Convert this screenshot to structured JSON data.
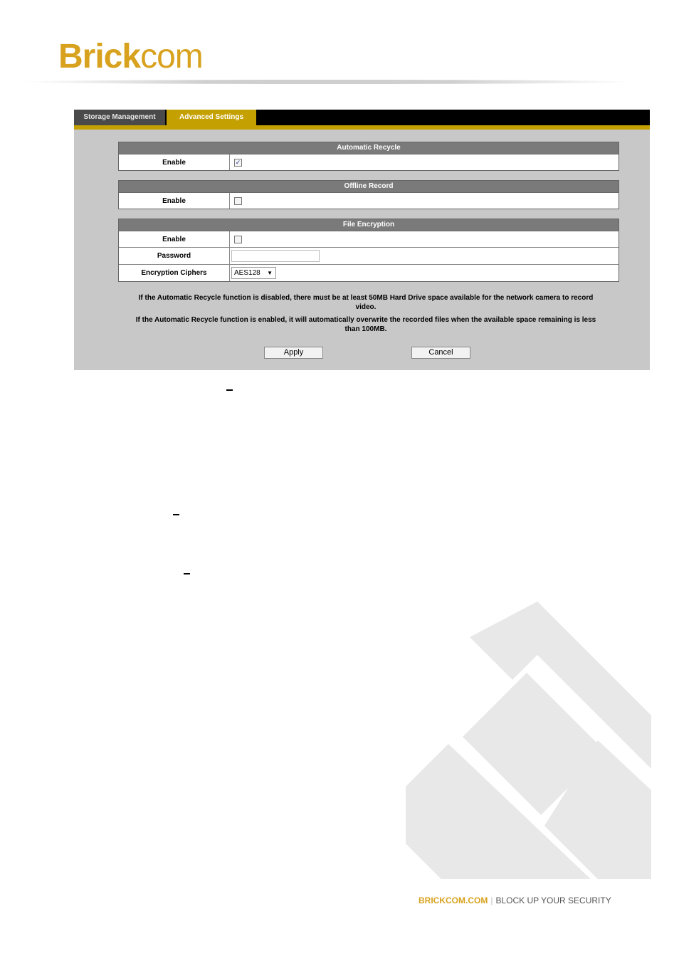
{
  "brand": {
    "logo_main": "Brick",
    "logo_suffix": "com",
    "color": "#d8a21e"
  },
  "tabs": [
    {
      "label": "Storage Management",
      "active": false
    },
    {
      "label": "Advanced Settings",
      "active": true
    }
  ],
  "automatic_recycle": {
    "title": "Automatic Recycle",
    "enable_label": "Enable",
    "enabled": true
  },
  "offline_record": {
    "title": "Offline Record",
    "enable_label": "Enable",
    "enabled": false
  },
  "file_encryption": {
    "title": "File Encryption",
    "enable_label": "Enable",
    "enabled": false,
    "password_label": "Password",
    "password_value": "",
    "cipher_label": "Encryption Ciphers",
    "cipher_value": "AES128"
  },
  "notes": {
    "line1": "If the Automatic Recycle function is disabled, there must be at least 50MB Hard Drive space available for the network camera to record video.",
    "line2": "If the Automatic Recycle function is enabled, it will automatically overwrite the recorded files when the available space remaining is less than 100MB."
  },
  "buttons": {
    "apply": "Apply",
    "cancel": "Cancel"
  },
  "footer": {
    "site": "BRICKCOM.COM",
    "slogan": "BLOCK UP YOUR SECURITY"
  },
  "colors": {
    "accent": "#c4a000",
    "panel_bg": "#c8c8c8",
    "section_header": "#7a7a7a"
  }
}
